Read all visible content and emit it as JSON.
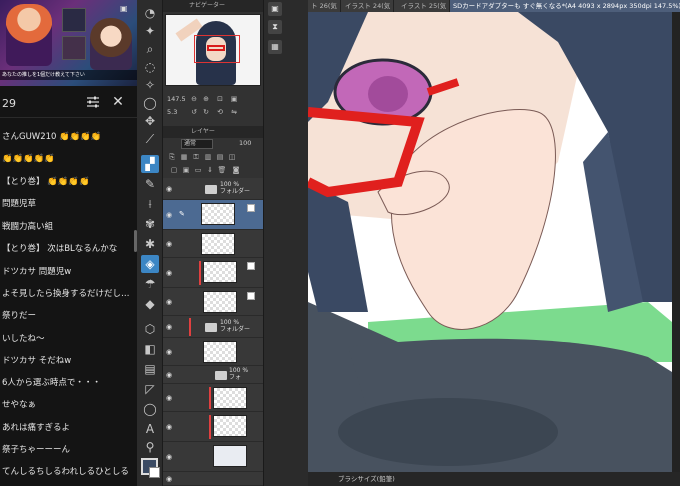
{
  "chat": {
    "viewer_count": "29",
    "video_banner": "あなたの推しを1個だけ教えて下さい",
    "messages": [
      "さんGUW210 👏👏👏👏",
      "👏👏👏👏👏",
      "【とり巻】 👏👏👏👏",
      "問題児草",
      "戦闘力高い組",
      "【とり巻】 次はBLなるんかな",
      "ドツカサ 問題児w",
      "よそ見したら換身するだけだし…",
      "祭りだー",
      "いしたね〜",
      "ドツカサ そだねw",
      "6人から選ぶ時点で・・・",
      "せやなぁ",
      "あれは痛すぎるよ",
      "祭子ちゃーーーん",
      "てんしるちしるわれしるひとしる"
    ]
  },
  "navigator": {
    "title": "ナビゲーター",
    "zoom": "147.5",
    "angle": "5.3"
  },
  "layers": {
    "title": "レイヤー",
    "blend_mode": "通常",
    "opacity": "100",
    "folder1_label": "100 %\nフォルダー",
    "folder2_label": "100 %\nフォルダー",
    "folder3_label": "100 %\nフォ"
  },
  "tabs": {
    "t1": "ト 26(気",
    "t2": "イラスト 24(気",
    "t3": "イラスト 25(気",
    "active": "SDカードアダプターも すぐ無くなる*(A4 4093 x 2894px 350dpi 147.5%)"
  },
  "status": {
    "brush_size": "ブラシサイズ(鉛筆)"
  },
  "colors": {
    "main_color": "#3a4a63",
    "sub_color": "#ffffff",
    "accent": "#3c86c4"
  }
}
